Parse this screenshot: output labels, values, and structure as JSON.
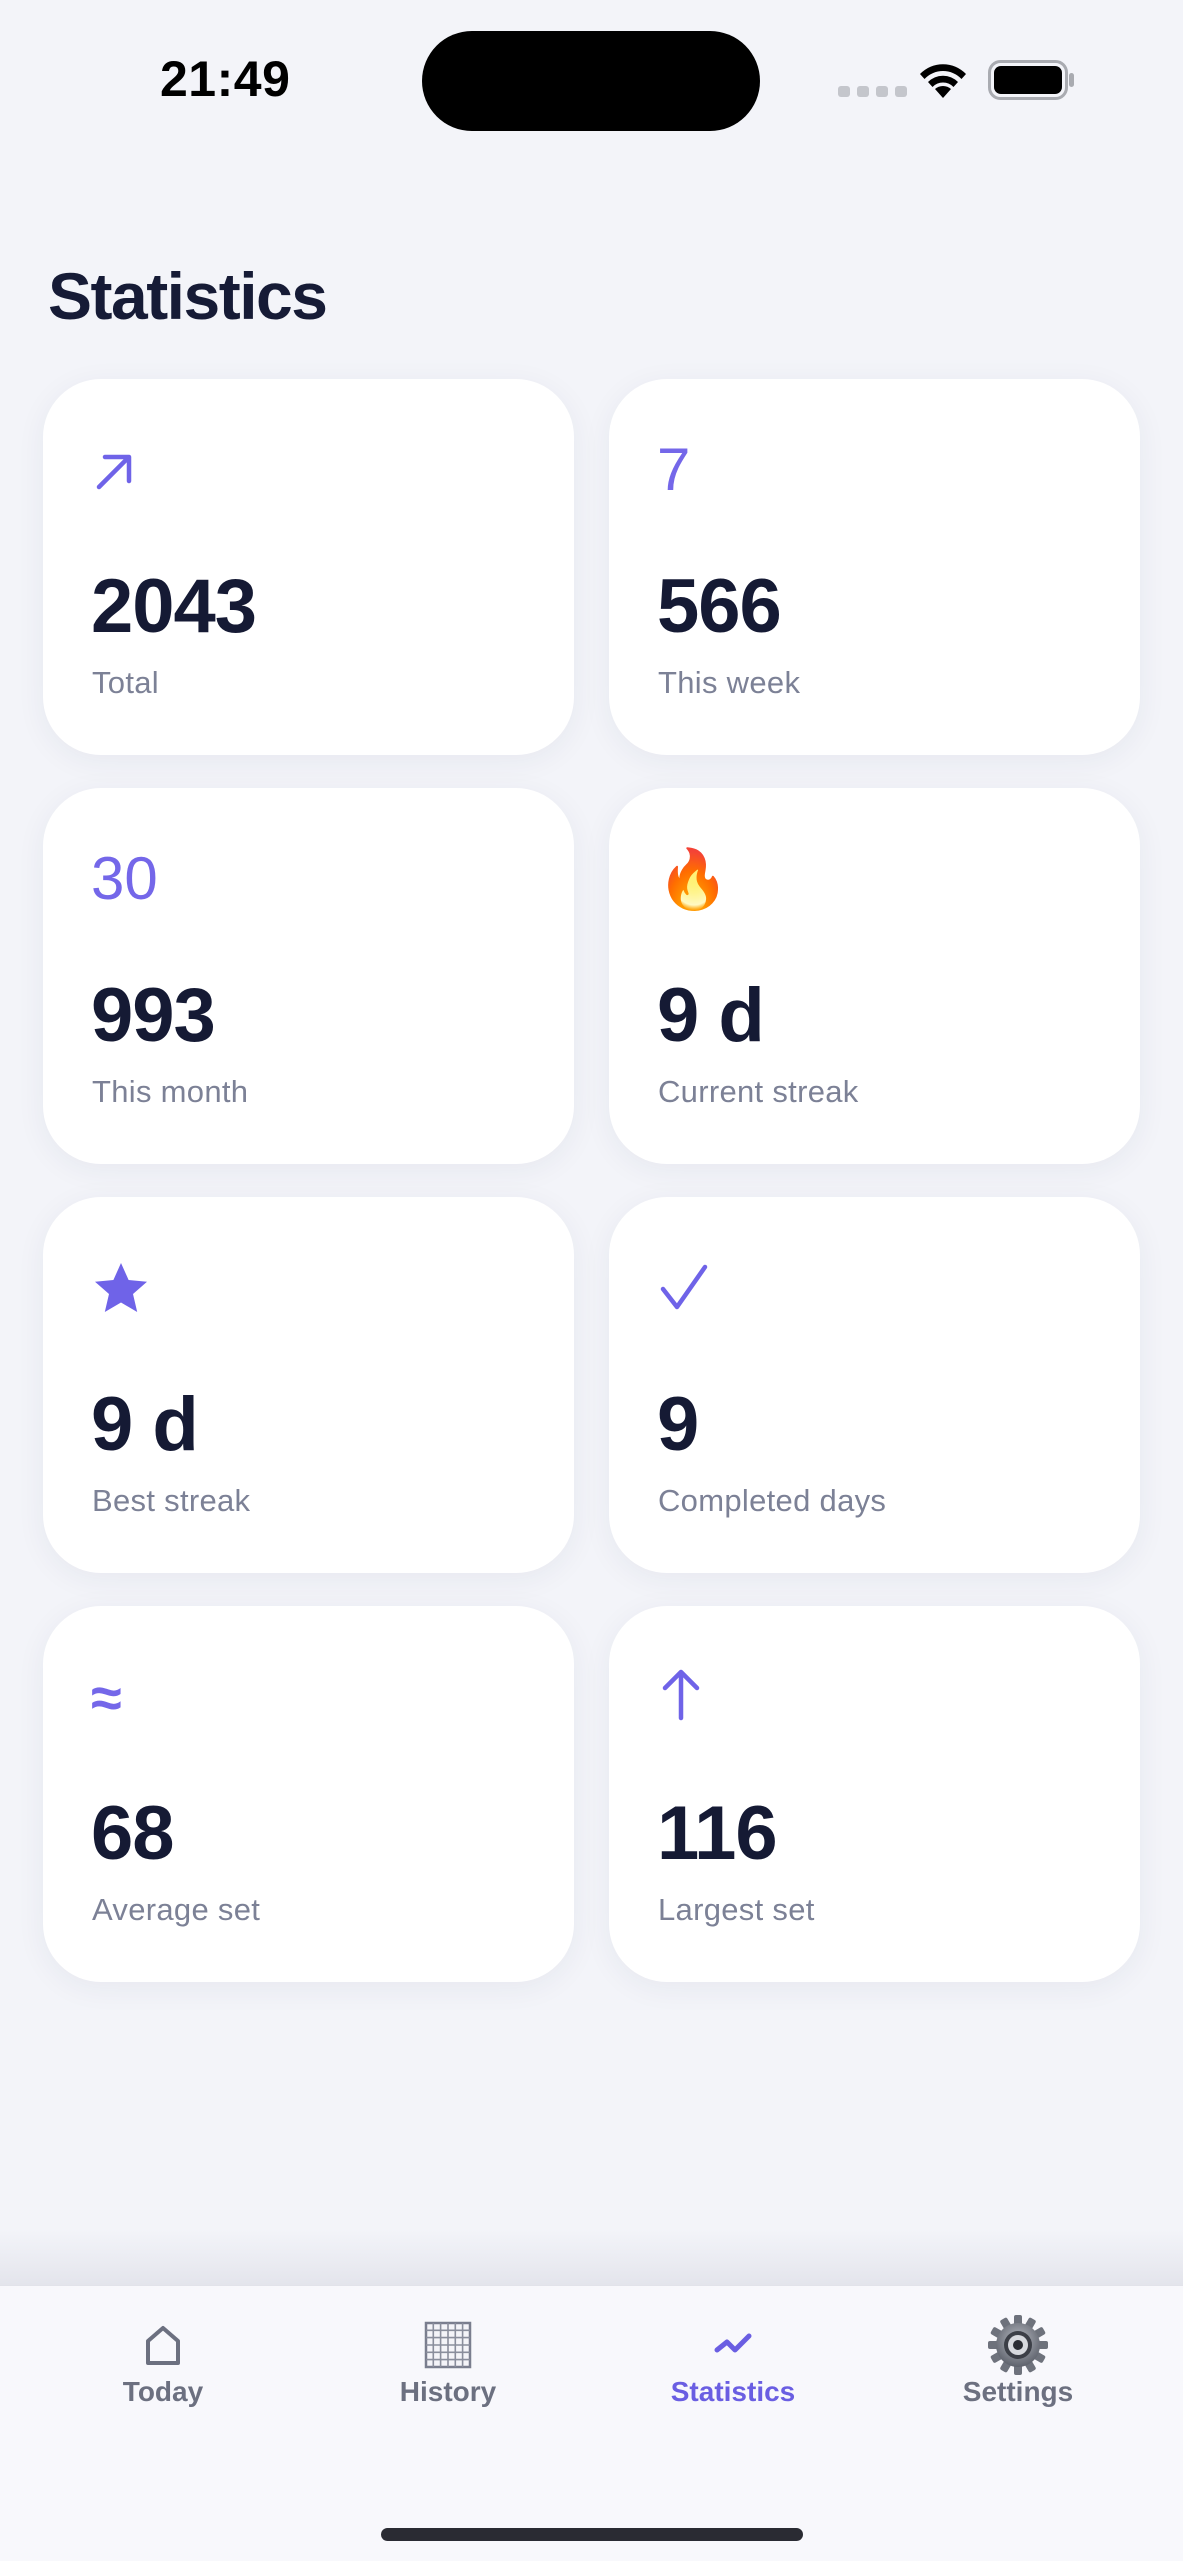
{
  "status_bar": {
    "time": "21:49"
  },
  "page": {
    "title": "Statistics"
  },
  "stats": [
    {
      "icon": "arrow-up-right-icon",
      "icon_text": "",
      "value": "2043",
      "label": "Total"
    },
    {
      "icon": "week-number-icon",
      "icon_text": "7",
      "value": "566",
      "label": "This week"
    },
    {
      "icon": "month-number-icon",
      "icon_text": "30",
      "value": "993",
      "label": "This month"
    },
    {
      "icon": "fire-icon",
      "icon_text": "🔥",
      "value": "9 d",
      "label": "Current streak"
    },
    {
      "icon": "star-icon",
      "icon_text": "",
      "value": "9 d",
      "label": "Best streak"
    },
    {
      "icon": "checkmark-icon",
      "icon_text": "",
      "value": "9",
      "label": "Completed days"
    },
    {
      "icon": "approx-icon",
      "icon_text": "≈",
      "value": "68",
      "label": "Average set"
    },
    {
      "icon": "arrow-up-icon",
      "icon_text": "",
      "value": "116",
      "label": "Largest set"
    }
  ],
  "tabs": [
    {
      "label": "Today",
      "icon": "home-icon",
      "active": false
    },
    {
      "label": "History",
      "icon": "grid-calendar-icon",
      "active": false
    },
    {
      "label": "Statistics",
      "icon": "statistics-icon",
      "active": true
    },
    {
      "label": "Settings",
      "icon": "gear-icon",
      "active": false
    }
  ],
  "colors": {
    "accent": "#6f63e8",
    "background": "#f3f4f9",
    "card": "#ffffff",
    "value_text": "#151a34",
    "label_text": "#7c8196",
    "tab_inactive": "#6c7080",
    "tab_active": "#6a5ee2"
  }
}
